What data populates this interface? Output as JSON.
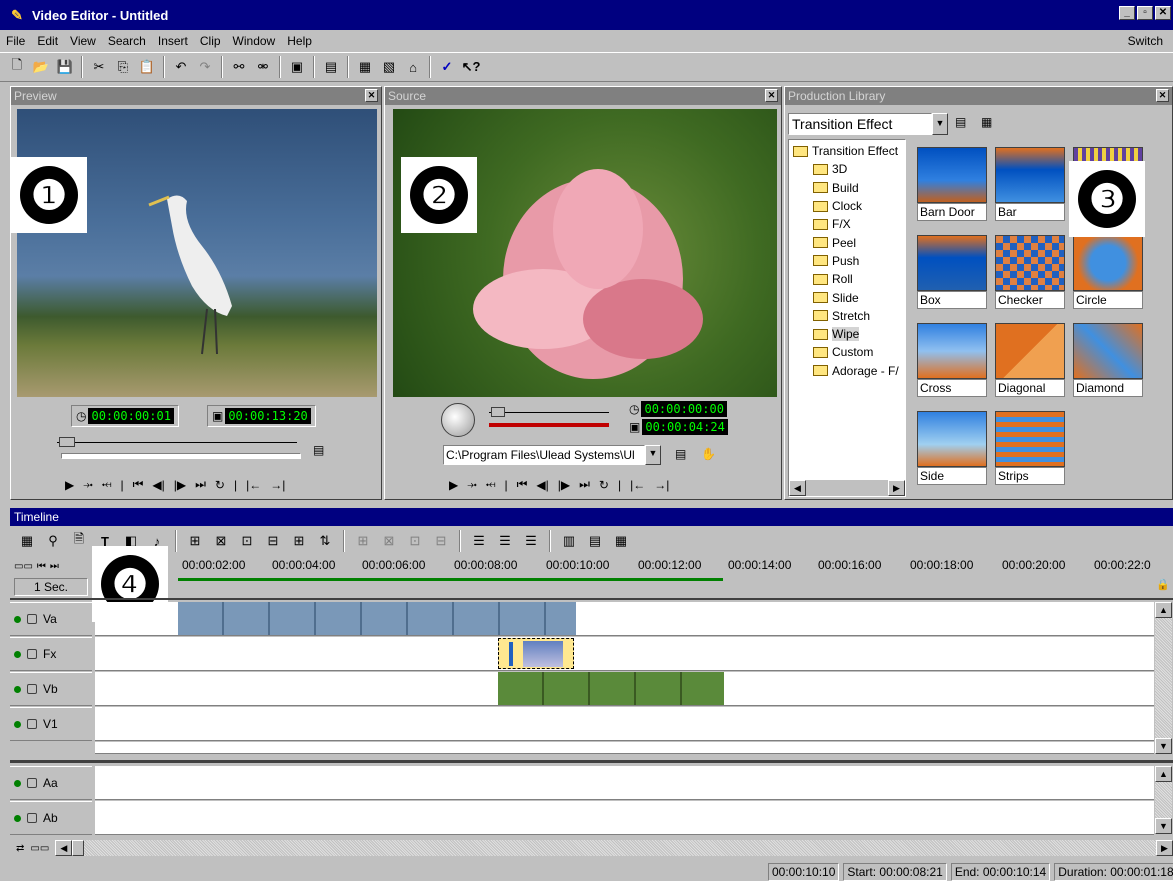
{
  "window": {
    "title": "Video Editor - Untitled"
  },
  "menu": {
    "items": [
      "File",
      "Edit",
      "View",
      "Search",
      "Insert",
      "Clip",
      "Window",
      "Help"
    ],
    "switch_label": "Switch"
  },
  "preview": {
    "title": "Preview",
    "badge": "❶",
    "timecode_current": "00:00:00:01",
    "timecode_duration": "00:00:13:20"
  },
  "source": {
    "title": "Source",
    "badge": "❷",
    "timecode_current": "00:00:00:00",
    "timecode_duration": "00:00:04:24",
    "path": "C:\\Program Files\\Ulead Systems\\Ul"
  },
  "library": {
    "title": "Production Library",
    "badge": "❸",
    "dropdown": "Transition Effect",
    "tree_root": "Transition Effect",
    "tree_items": [
      "3D",
      "Build",
      "Clock",
      "F/X",
      "Peel",
      "Push",
      "Roll",
      "Slide",
      "Stretch",
      "Wipe",
      "Custom",
      "Adorage - F/"
    ],
    "thumbs": [
      "Barn Door",
      "Bar",
      "",
      "Box",
      "Checker",
      "Circle",
      "Cross",
      "Diagonal",
      "Diamond",
      "Side",
      "Strips"
    ]
  },
  "timeline": {
    "title": "Timeline",
    "badge": "❹",
    "scale": "1 Sec.",
    "ruler": [
      "00:00:02:00",
      "00:00:04:00",
      "00:00:06:00",
      "00:00:08:00",
      "00:00:10:00",
      "00:00:12:00",
      "00:00:14:00",
      "00:00:16:00",
      "00:00:18:00",
      "00:00:20:00",
      "00:00:22:0"
    ],
    "tracks": [
      "Va",
      "Fx",
      "Vb",
      "V1",
      "Aa",
      "Ab"
    ]
  },
  "status": {
    "position": "00:00:10:10",
    "start": "Start: 00:00:08:21",
    "end": "End: 00:00:10:14",
    "duration": "Duration: 00:00:01:18"
  }
}
